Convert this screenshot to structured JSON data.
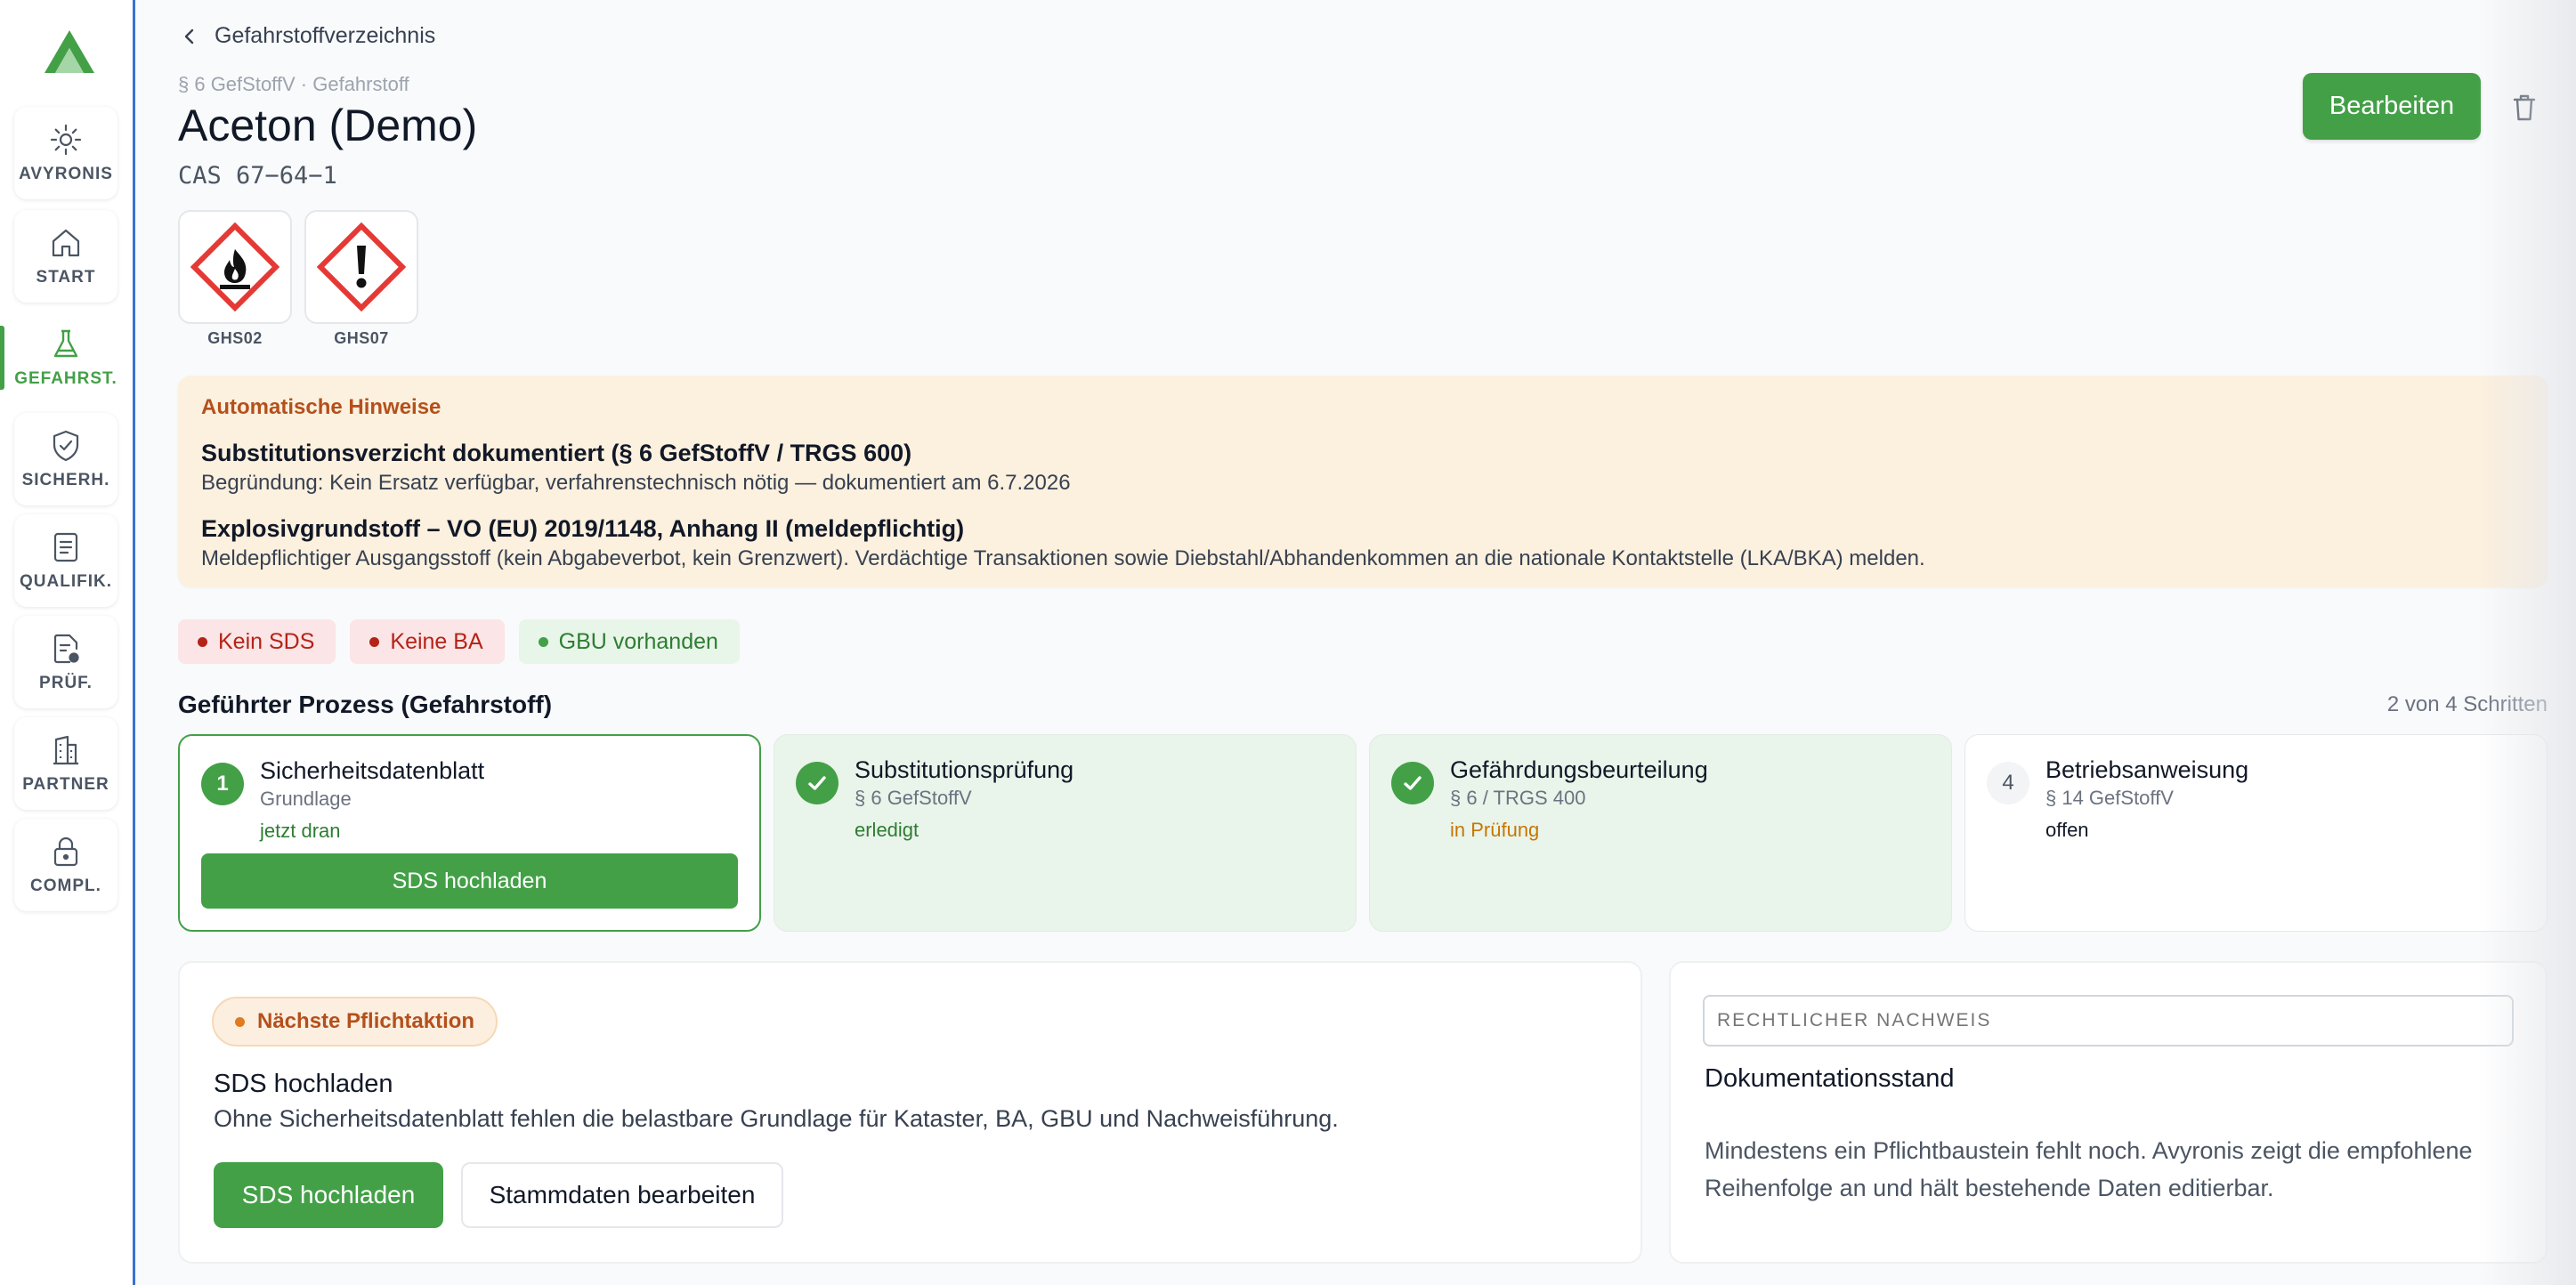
{
  "sidebar": {
    "items": [
      {
        "label": "AVYRONIS",
        "icon": "sun-icon"
      },
      {
        "label": "START",
        "icon": "home-icon"
      },
      {
        "label": "GEFAHRST.",
        "icon": "flask-icon",
        "active": true
      },
      {
        "label": "SICHERH.",
        "icon": "shield-check-icon"
      },
      {
        "label": "QUALIFIK.",
        "icon": "document-list-icon"
      },
      {
        "label": "PRÜF.",
        "icon": "document-gear-icon"
      },
      {
        "label": "PARTNER",
        "icon": "building-icon"
      },
      {
        "label": "COMPL.",
        "icon": "lock-icon"
      }
    ],
    "accent_color": "#43a047"
  },
  "header": {
    "back_label": "Gefahrstoffverzeichnis",
    "breadcrumb": "§ 6 GefStoffV · Gefahrstoff",
    "title": "Aceton (Demo)",
    "cas": "CAS 67−64−1",
    "edit_label": "Bearbeiten"
  },
  "pictograms": [
    {
      "code": "GHS02",
      "icon": "flame-pictogram-icon"
    },
    {
      "code": "GHS07",
      "icon": "exclamation-pictogram-icon"
    }
  ],
  "hints": {
    "title": "Automatische Hinweise",
    "items": [
      {
        "heading": "Substitutionsverzicht dokumentiert (§ 6 GefStoffV / TRGS 600)",
        "text": "Begründung: Kein Ersatz verfügbar, verfahrenstechnisch nötig — dokumentiert am 6.7.2026"
      },
      {
        "heading": "Explosivgrundstoff – VO (EU) 2019/1148, Anhang II (meldepflichtig)",
        "text": "Meldepflichtiger Ausgangsstoff (kein Abgabeverbot, kein Grenzwert). Verdächtige Transaktionen sowie Diebstahl/Abhandenkommen an die nationale Kontaktstelle (LKA/BKA) melden."
      }
    ]
  },
  "status_badges": [
    {
      "label": "Kein SDS",
      "tone": "red"
    },
    {
      "label": "Keine BA",
      "tone": "red"
    },
    {
      "label": "GBU vorhanden",
      "tone": "green"
    }
  ],
  "process": {
    "title": "Geführter Prozess (Gefahrstoff)",
    "progress": "2 von 4 Schritten",
    "steps": [
      {
        "num": "1",
        "name": "Sicherheitsdatenblatt",
        "sub": "Grundlage",
        "state": "jetzt dran",
        "button": "SDS hochladen"
      },
      {
        "num": "2",
        "name": "Substitutionsprüfung",
        "sub": "§ 6 GefStoffV",
        "state": "erledigt"
      },
      {
        "num": "3",
        "name": "Gefährdungsbeurteilung",
        "sub": "§ 6 / TRGS 400",
        "state": "in Prüfung"
      },
      {
        "num": "4",
        "name": "Betriebsanweisung",
        "sub": "§ 14 GefStoffV",
        "state": "offen"
      }
    ]
  },
  "next_action": {
    "pill": "Nächste Pflichtaktion",
    "title": "SDS hochladen",
    "description": "Ohne Sicherheitsdatenblatt fehlen die belastbare Grundlage für Kataster, BA, GBU und Nachweisführung.",
    "primary_label": "SDS hochladen",
    "secondary_label": "Stammdaten bearbeiten"
  },
  "legal": {
    "placeholder": "RECHTLICHER NACHWEIS",
    "title": "Dokumentationsstand",
    "description": "Mindestens ein Pflichtbaustein fehlt noch. Avyronis zeigt die empfohlene Reihenfolge an und hält bestehende Daten editierbar."
  }
}
